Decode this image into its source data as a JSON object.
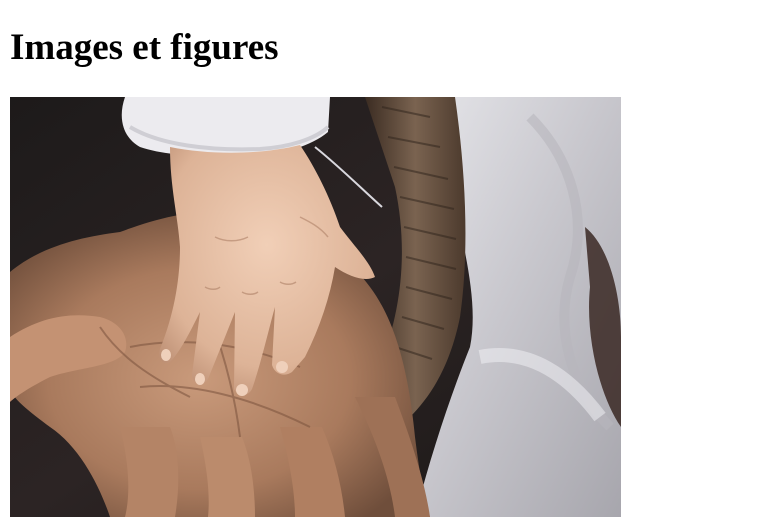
{
  "page": {
    "title": "Images et figures"
  },
  "figure": {
    "subject": "baby-hand-on-adult-palm-photo"
  }
}
